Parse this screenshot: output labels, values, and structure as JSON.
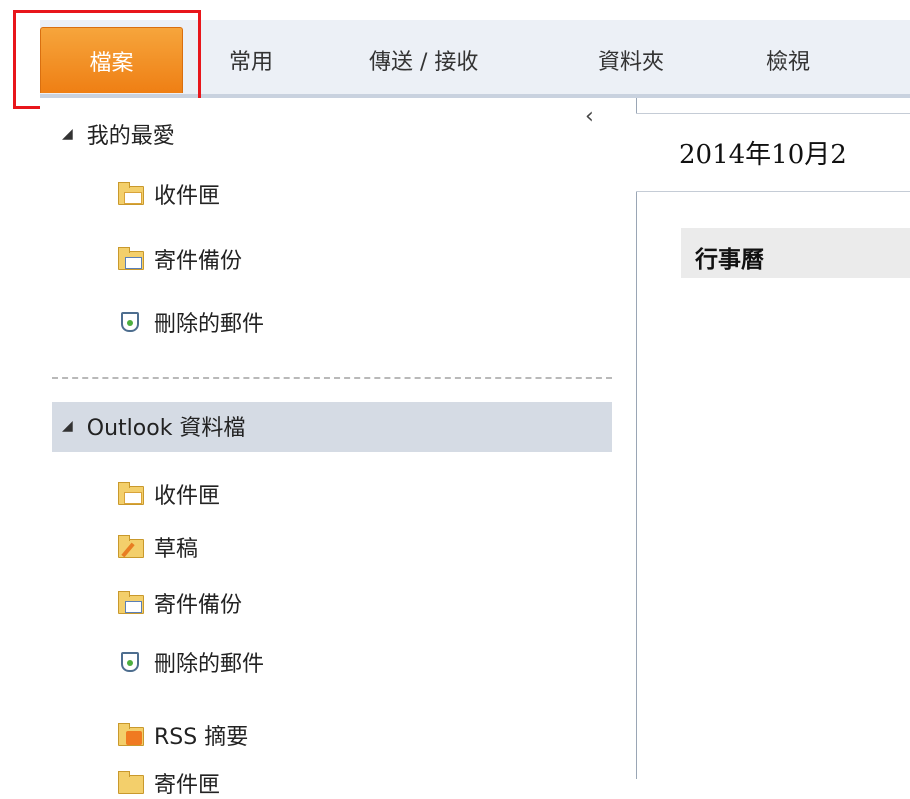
{
  "ribbon": {
    "tabs": [
      "檔案",
      "常用",
      "傳送 / 接收",
      "資料夾",
      "檢視"
    ],
    "active_tab": "檔案",
    "active_color": "#f39a2c",
    "highlight_color": "#e8161b"
  },
  "nav": {
    "collapse_glyph": "‹",
    "favorites": {
      "title": "我的最愛",
      "items": [
        "收件匣",
        "寄件備份",
        "刪除的郵件"
      ]
    },
    "mailbox": {
      "title": "Outlook 資料檔",
      "items": [
        "收件匣",
        "草稿",
        "寄件備份",
        "刪除的郵件",
        "RSS 摘要",
        "寄件匣"
      ]
    }
  },
  "main": {
    "date_header": "2014年10月2",
    "calendar_label": "行事曆"
  }
}
